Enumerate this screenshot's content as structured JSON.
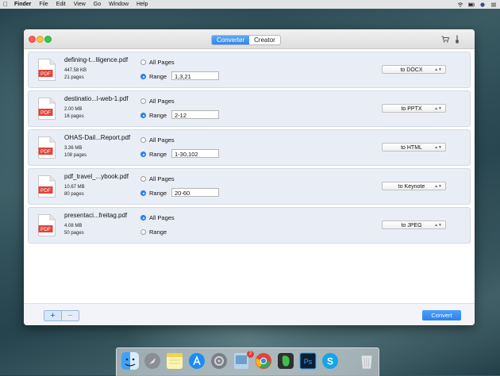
{
  "menubar": {
    "items": [
      "Finder",
      "File",
      "Edit",
      "View",
      "Go",
      "Window",
      "Help"
    ]
  },
  "window": {
    "tabs": [
      {
        "label": "Converter",
        "active": true
      },
      {
        "label": "Creator",
        "active": false
      }
    ]
  },
  "files": [
    {
      "name": "defining-t...lligence.pdf",
      "size": "447.58 KB",
      "pages": "21 pages",
      "all_label": "All Pages",
      "range_label": "Range",
      "selected": "range",
      "range": "1,3,21",
      "format": "to DOCX"
    },
    {
      "name": "destinatio...l-web-1.pdf",
      "size": "2.00 MB",
      "pages": "16 pages",
      "all_label": "All Pages",
      "range_label": "Range",
      "selected": "range",
      "range": "2-12",
      "format": "to PPTX"
    },
    {
      "name": "OHAS-Dail...Report.pdf",
      "size": "3.36 MB",
      "pages": "108 pages",
      "all_label": "All Pages",
      "range_label": "Range",
      "selected": "range",
      "range": "1-30,102",
      "format": "to HTML"
    },
    {
      "name": "pdf_travel_...ybook.pdf",
      "size": "10.67 MB",
      "pages": "80 pages",
      "all_label": "All Pages",
      "range_label": "Range",
      "selected": "range",
      "range": "20-60",
      "format": "to Keynote"
    },
    {
      "name": "presentaci...freitag.pdf",
      "size": "4.08 MB",
      "pages": "50 pages",
      "all_label": "All Pages",
      "range_label": "Range",
      "selected": "all",
      "range": "",
      "format": "to JPEG"
    }
  ],
  "pdf_icon_label": "PDF",
  "bottom": {
    "plus": "+",
    "minus": "−",
    "convert": "Convert"
  },
  "dock": {
    "badge": "2",
    "icons": [
      "finder-icon",
      "launchpad-icon",
      "notes-icon",
      "app-store-icon",
      "system-preferences-icon",
      "preview-icon",
      "chrome-icon",
      "evernote-icon",
      "photoshop-icon",
      "skype-icon",
      "trash-icon"
    ]
  }
}
